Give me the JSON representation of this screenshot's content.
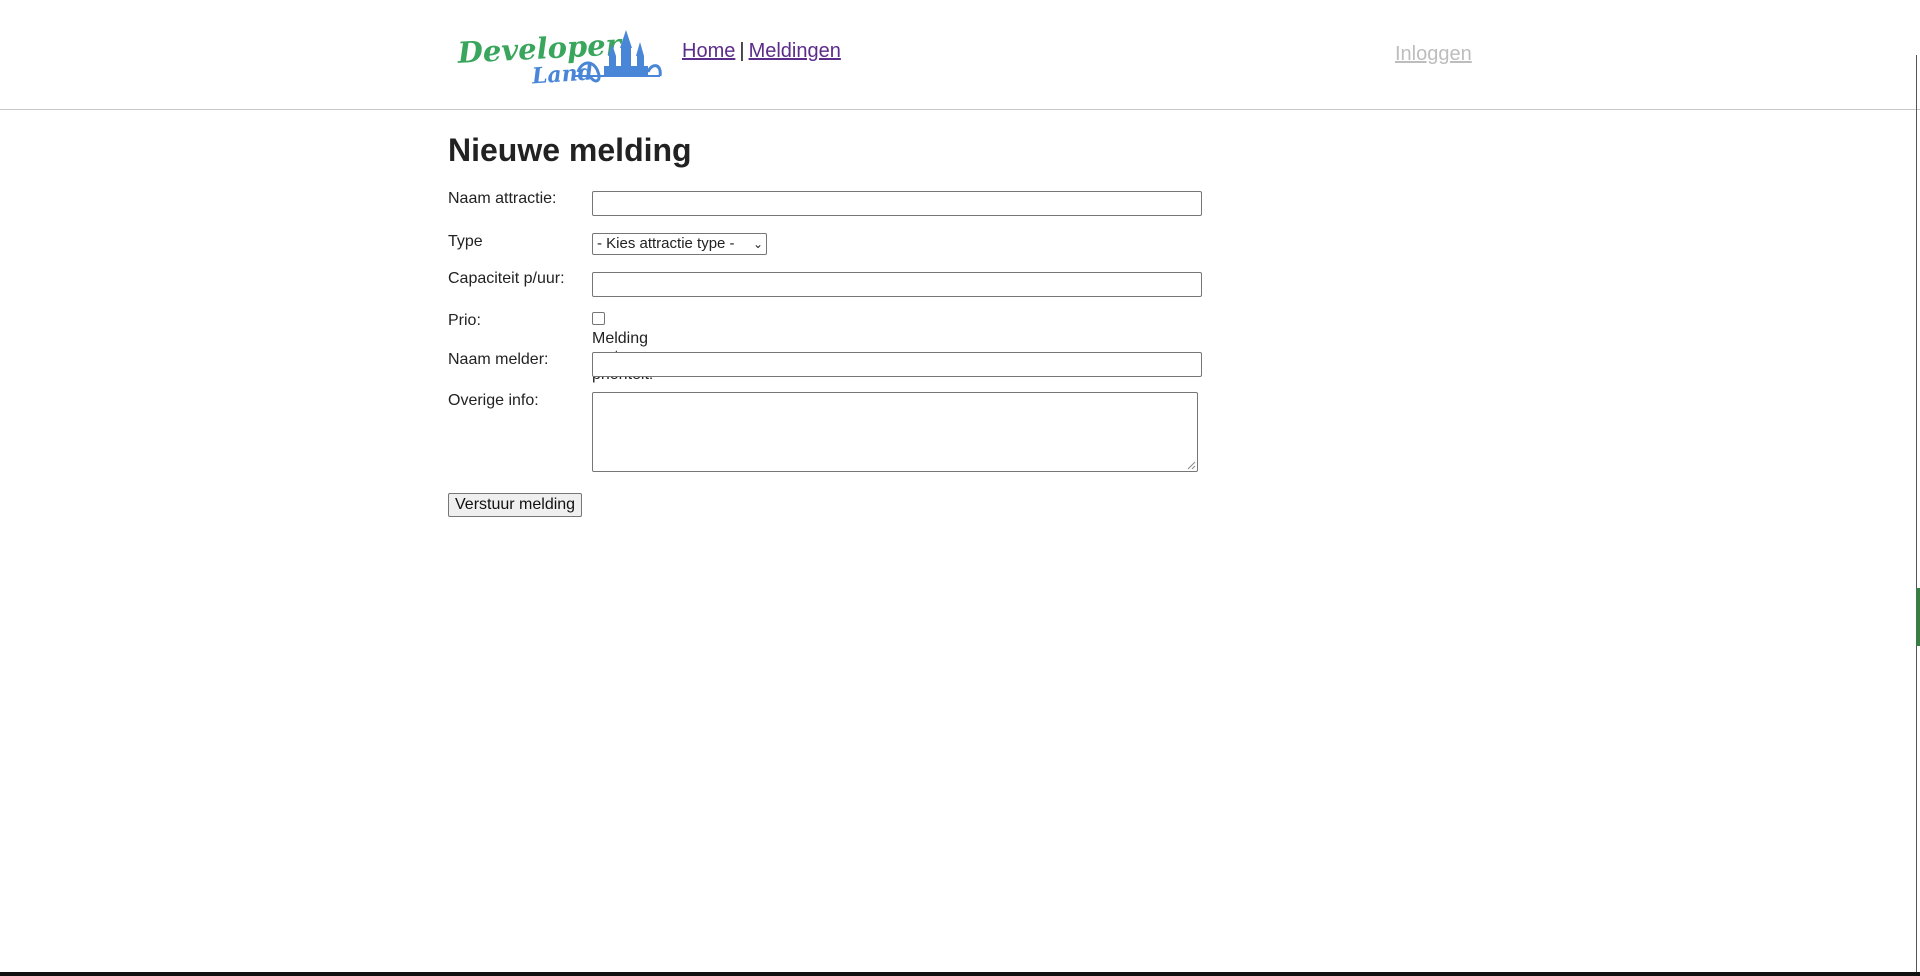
{
  "header": {
    "logo_text": "Developer Land",
    "nav": {
      "home": "Home",
      "separator": "|",
      "meldingen": "Meldingen"
    },
    "login": "Inloggen"
  },
  "form": {
    "title": "Nieuwe melding",
    "fields": {
      "naam_attractie": {
        "label": "Naam attractie:",
        "value": ""
      },
      "type": {
        "label": "Type",
        "selected": "- Kies attractie type -"
      },
      "capaciteit": {
        "label": "Capaciteit p/uur:",
        "value": ""
      },
      "prio": {
        "label": "Prio:",
        "checkbox_label": "Melding met prioriteit!",
        "checked": false
      },
      "naam_melder": {
        "label": "Naam melder:",
        "value": ""
      },
      "overige_info": {
        "label": "Overige info:",
        "value": ""
      }
    },
    "submit_label": "Verstuur melding"
  },
  "colors": {
    "link": "#5b2c8a",
    "login_link": "#bdbdbd",
    "logo_green": "#3aa55c",
    "logo_blue": "#4a86d8"
  }
}
